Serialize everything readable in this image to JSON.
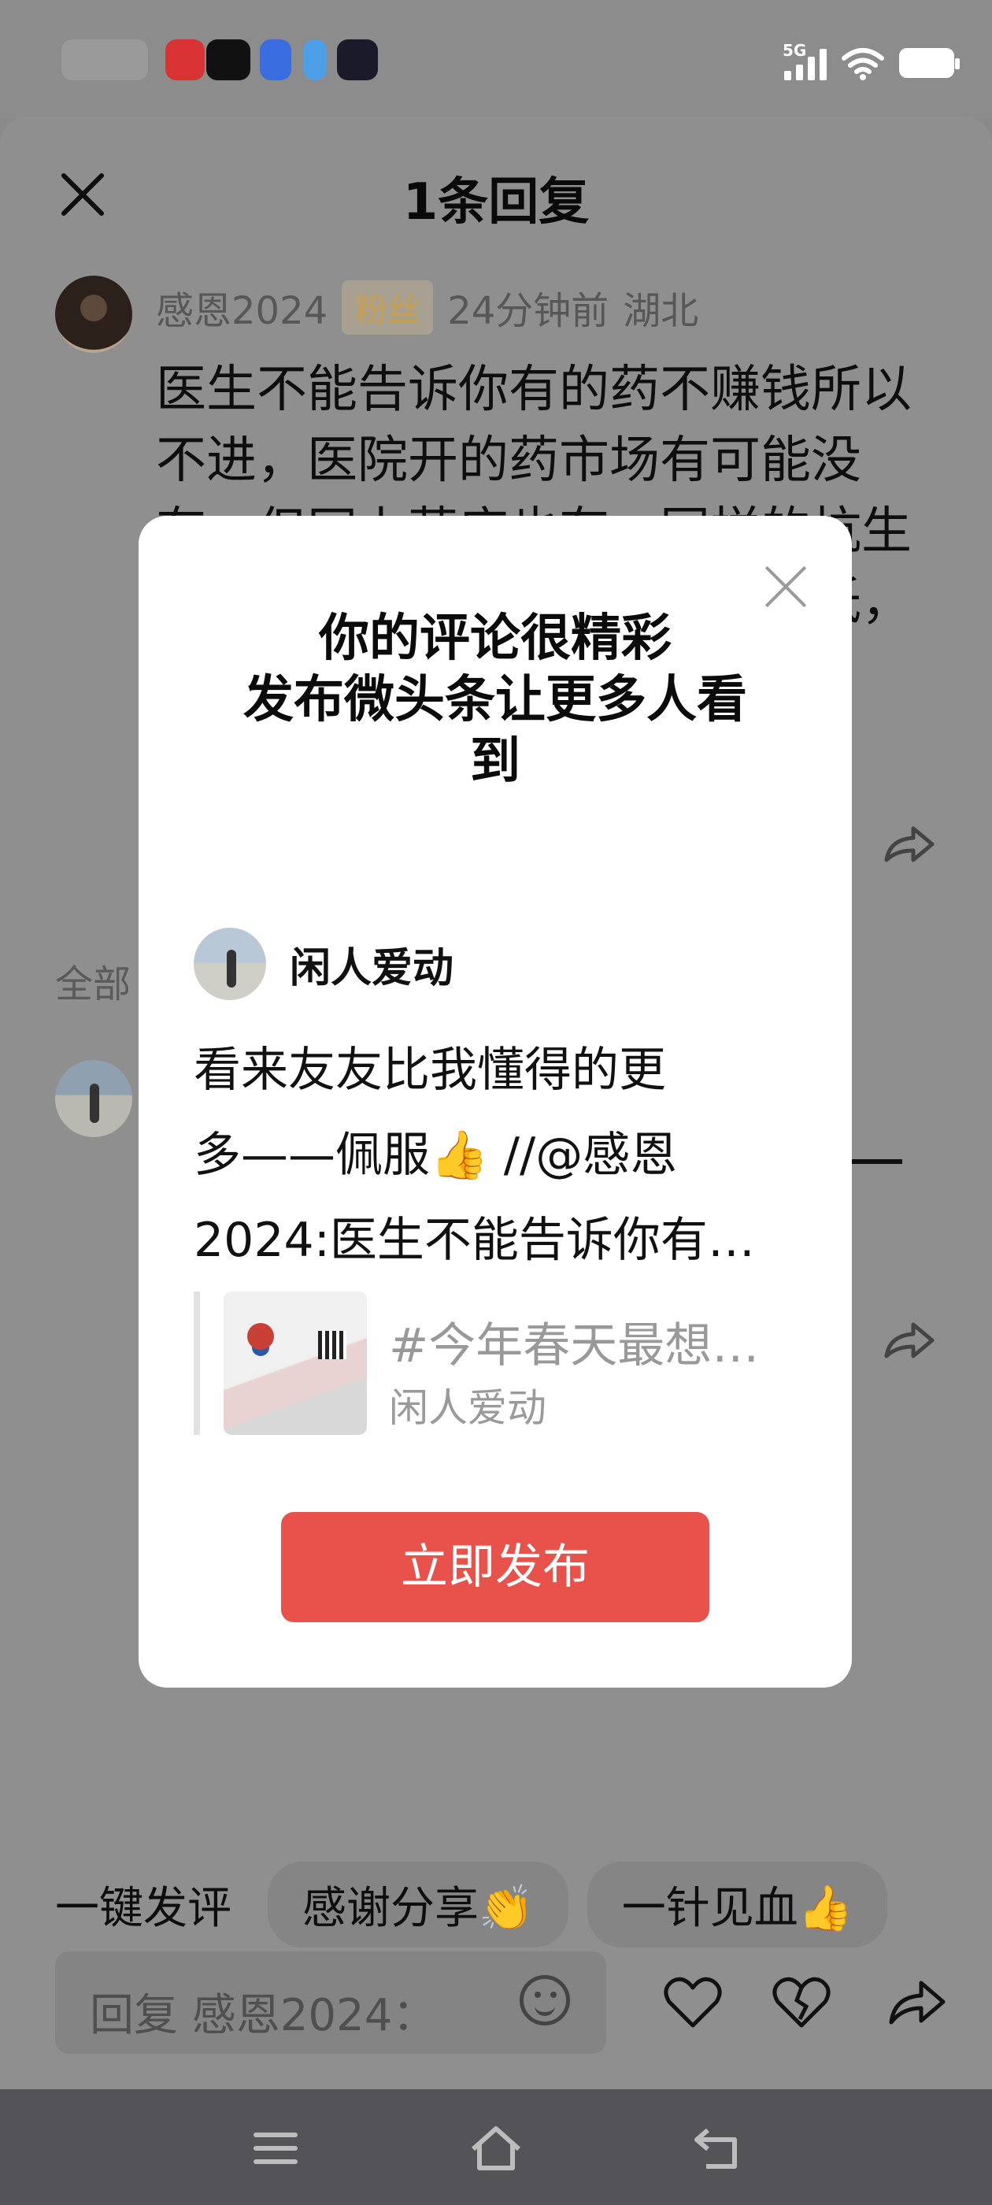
{
  "sheet": {
    "title": "1条回复"
  },
  "comment": {
    "user": "感恩2024",
    "badge": "粉丝",
    "time": "24分钟前",
    "location": "湖北",
    "text": "医生不能告诉你有的药不赚钱所以不进，医院开的药市场有可能没有，但网上药店也有，同样的抗生素类药医院不进是因为利润太低，开出来没有提成，这种事"
  },
  "section": {
    "all_label": "全部"
  },
  "modal": {
    "title_lines": [
      "你的评论很精彩",
      "发布微头条让更多人看",
      "到"
    ],
    "user": "闲人爱动",
    "text": "看来友友比我懂得的更\n多——佩服👍 //@感恩\n2024:医生不能告诉你有…",
    "card_title": "#今年春天最想…",
    "card_author": "闲人爱动",
    "publish_label": "立即发布"
  },
  "quick_replies": {
    "label": "一键发评",
    "chips": [
      "感谢分享👏",
      "一针见血👍"
    ]
  },
  "reply_box": {
    "placeholder": "回复 感恩2024："
  },
  "icons": {
    "close": "close-icon",
    "share": "share-icon",
    "emoji": "smile-icon",
    "like": "heart-icon",
    "dislike": "broken-heart-icon",
    "forward": "forward-icon",
    "menu": "menu-icon",
    "home": "home-icon",
    "back": "back-icon"
  },
  "colors": {
    "primary": "#e8524a",
    "overlay": "#8f8f8f",
    "navbar": "#545458"
  }
}
